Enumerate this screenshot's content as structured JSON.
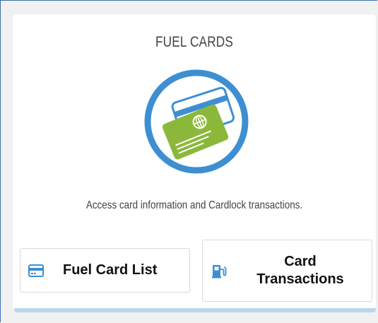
{
  "panel": {
    "title": "FUEL CARDS",
    "description": "Access card information and Cardlock transactions.",
    "hero_icon": "fuel-card-icon"
  },
  "buttons": {
    "fuel_card_list": {
      "label": "Fuel Card List",
      "icon": "credit-card-icon"
    },
    "card_transactions": {
      "label_line1": "Card",
      "label_line2": "Transactions",
      "icon": "fuel-pump-icon"
    }
  },
  "colors": {
    "accent_blue": "#3d8fd1",
    "card_green": "#8bb83a",
    "light_blue": "#b9d8ee",
    "frame_border": "#3c6fb4"
  }
}
